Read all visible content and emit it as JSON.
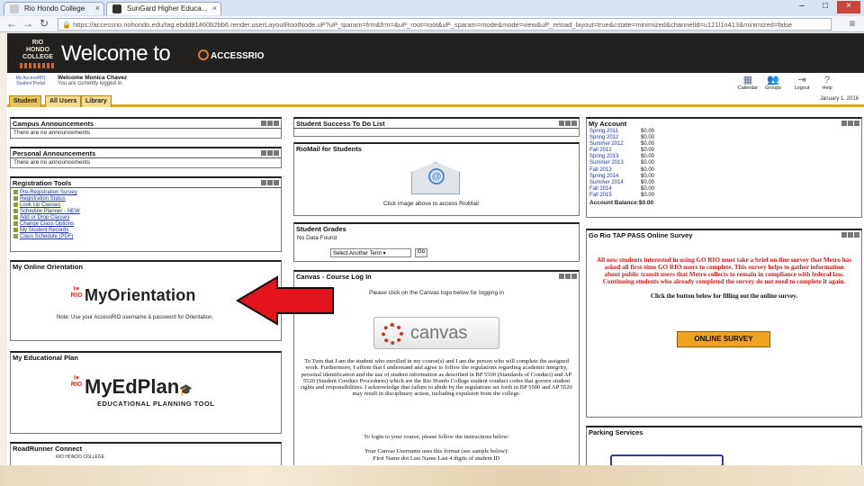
{
  "browser": {
    "tabs": [
      {
        "title": "Rio Hondo College"
      },
      {
        "title": "SunGard Higher Educa..."
      }
    ],
    "url": "https://accessrio.riohondo.edu/tag.ebdd81460b2bb6.render.userLayoutRootNode.uP?uP_tparam=frm&frm=&uP_root=root&uP_sparam=mode&mode=view&uP_reload_layout=true&cstate=minimized&channelId=u121l1n413&minimized=false"
  },
  "header": {
    "college": "RIO HONDO COLLEGE",
    "welcome": "Welcome to",
    "brand": "ACCESSRIO",
    "myaccess": "My AccessRIO Student Portal",
    "user_line": "Welcome Monica Chavez",
    "user_sub": "You are currently logged in.",
    "tools": [
      {
        "label": "Calendar",
        "icon": "calendar-icon",
        "g": "▦"
      },
      {
        "label": "Groups",
        "icon": "groups-icon",
        "g": "👥"
      },
      {
        "label": "Logout",
        "icon": "logout-icon",
        "g": "⇥"
      },
      {
        "label": "Help",
        "icon": "help-icon",
        "g": "?"
      }
    ]
  },
  "tabs": [
    "Student",
    "All Users",
    "Library"
  ],
  "date": "January 1, 2016",
  "campus": {
    "title": "Campus Announcements",
    "body": "There are no announcements"
  },
  "personal": {
    "title": "Personal Announcements",
    "body": "There are no announcements"
  },
  "regtools": {
    "title": "Registration Tools",
    "links": [
      "Pre-Registration Survey",
      "Registration Status",
      "Look Up Classes",
      "Schedule Planner - NEW",
      "Add or Drop Classes",
      "Change Class Options",
      "My Student Records",
      "Class Schedule (PDF)"
    ]
  },
  "orientation": {
    "title": "My Online Orientation",
    "logo": "MyOrientation",
    "note": "Note: Use your AccessRIO username & password for Orientation."
  },
  "edplan": {
    "title": "My Educational Plan",
    "logo": "MyEdPlan",
    "sub": "EDUCATIONAL PLANNING TOOL"
  },
  "roadrunner": {
    "title": "RoadRunner Connect",
    "text": "RIO HONDO COLLEGE"
  },
  "todo": {
    "title": "Student Success To Do List"
  },
  "riomail": {
    "title": "RioMail for Students",
    "caption": "Click image above to access RioMail"
  },
  "grades": {
    "title": "Student Grades",
    "body": "No Data Found",
    "select": "Select Another Term",
    "go": "Go"
  },
  "canvas": {
    "title": "Canvas - Course Log In",
    "intro": "Please click on the Canvas logo below for logging in",
    "logo": "canvas",
    "policy": "To Turn that I am the student who enrolled in my course(s) and I am the person who will complete the assigned work. Furthermore, I affirm that I understand and agree to follow the regulations regarding academic integrity, personal identification and the use of student information as described in BP 5500 (Standards of Conduct) and AP 5520 (Student Conduct Procedures) which are the Rio Hondo College student conduct codes that govern student rights and responsibilities. I acknowledge that failure to abide by the regulations set forth in BP 5500 and AP 5520 may result in disciplinary action, including expulsion from the college.",
    "login": "To login to your course, please follow the instructions below:",
    "user1": "Your Canvas Username uses this format (see sample below):",
    "user2": "First Name dot Last Name Last 4 digits of student ID"
  },
  "account": {
    "title": "My Account",
    "rows": [
      [
        "Spring 2011",
        "$0.00"
      ],
      [
        "Spring 2012",
        "$0.00"
      ],
      [
        "Summer 2012",
        "$0.00"
      ],
      [
        "Fall 2012",
        "$0.00"
      ],
      [
        "Spring 2013",
        "$0.00"
      ],
      [
        "Summer 2013",
        "$0.00"
      ],
      [
        "Fall 2013",
        "$0.00"
      ],
      [
        "Spring 2014",
        "$0.00"
      ],
      [
        "Summer 2014",
        "$0.00"
      ],
      [
        "Fall 2014",
        "$0.00"
      ],
      [
        "Fall 2015",
        "$0.00"
      ]
    ],
    "balance": "Account Balance:$0.00"
  },
  "tap": {
    "title": "Go Rio TAP PASS Online Survey",
    "red": "All new students interested in using GO RIO must take a brief on-line survey that Metro has asked all first-time GO RIO users to complete. This survey helps to gather information about public transit users that Metro collects to remain in compliance with federal law. Continuing students who already completed the survey do not need to complete it again.",
    "instruction": "Click the button below for filling out the online survey.",
    "button": "ONLINE SURVEY"
  },
  "parking": {
    "title": "Parking Services"
  },
  "colors": {
    "header_bg": "#23211f",
    "tab_accent": "#e8a817",
    "arrow": "#e3141b",
    "survey_red": "#d11b1b"
  }
}
